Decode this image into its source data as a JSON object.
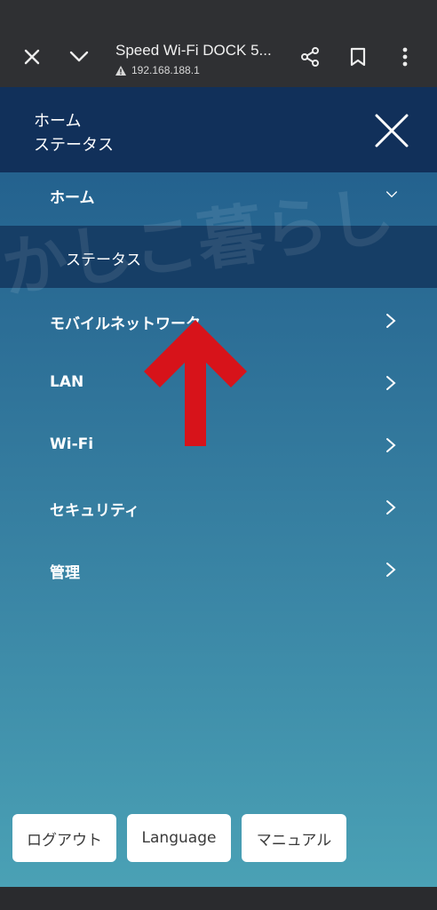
{
  "browser": {
    "title": "Speed Wi-Fi DOCK 5...",
    "url": "192.168.188.1"
  },
  "header": {
    "line1": "ホーム",
    "line2": "ステータス"
  },
  "menu": {
    "home": "ホーム",
    "status": "ステータス",
    "mobile_network": "モバイルネットワーク",
    "lan": "LAN",
    "wifi": "Wi-Fi",
    "security": "セキュリティ",
    "admin": "管理"
  },
  "watermark": "かしこ暮らし",
  "buttons": {
    "logout": "ログアウト",
    "language": "Language",
    "manual": "マニュアル"
  },
  "colors": {
    "header_bg": "#11305a",
    "arrow": "#d7131a"
  }
}
